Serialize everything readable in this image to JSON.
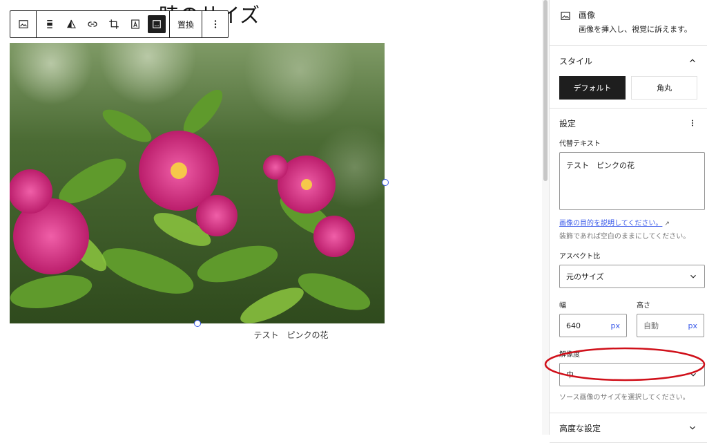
{
  "canvas": {
    "heading": "時のサイズ",
    "caption": "テスト　ピンクの花",
    "toolbar": {
      "replace_label": "置換"
    }
  },
  "sidebar": {
    "block": {
      "title": "画像",
      "description": "画像を挿入し、視覚に訴えます。"
    },
    "styles": {
      "title": "スタイル",
      "default_label": "デフォルト",
      "rounded_label": "角丸"
    },
    "settings": {
      "title": "設定",
      "alt_label": "代替テキスト",
      "alt_value": "テスト　ピンクの花",
      "alt_help_link": "画像の目的を説明してください。",
      "alt_help_ext": "↗",
      "alt_help": "装飾であれば空白のままにしてください。",
      "aspect_label": "アスペクト比",
      "aspect_value": "元のサイズ",
      "width_label": "幅",
      "width_value": "640",
      "width_unit": "px",
      "height_label": "高さ",
      "height_placeholder": "自動",
      "height_unit": "px",
      "resolution_label": "解像度",
      "resolution_value": "中",
      "resolution_help": "ソース画像のサイズを選択してください。"
    },
    "advanced": {
      "title": "高度な設定"
    }
  },
  "colors": {
    "accent": "#3858e9",
    "annotation": "#d0101a",
    "dark": "#1e1e1e"
  }
}
